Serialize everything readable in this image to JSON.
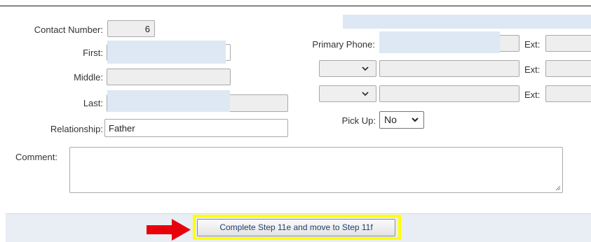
{
  "form": {
    "contact_number_label": "Contact Number:",
    "contact_number_value": "6",
    "first_label": "First:",
    "first_value": "",
    "middle_label": "Middle:",
    "middle_value": "",
    "last_label": "Last:",
    "last_value": "",
    "relationship_label": "Relationship:",
    "relationship_value": "Father",
    "comment_label": "Comment:",
    "comment_value": ""
  },
  "phones": {
    "primary_label": "Primary Phone:",
    "ext_label": "Ext:",
    "ext_label_2": "Ext:",
    "ext_label_3": "Ext:",
    "primary_value": "",
    "phone2_type": "",
    "phone3_type": ""
  },
  "pickup": {
    "label": "Pick Up:",
    "value": "No"
  },
  "footer": {
    "button_label": "Complete Step 11e and move to Step 11f"
  },
  "colors": {
    "redacted_highlight": "#dde8f4",
    "annotation_arrow": "#e8000b",
    "annotation_box": "#ffff00",
    "footer_bg": "#e9eef4"
  },
  "icons": {
    "dropdown": "chevron-down-icon",
    "annotation": "red-arrow-icon",
    "resize": "resize-grip-icon"
  }
}
